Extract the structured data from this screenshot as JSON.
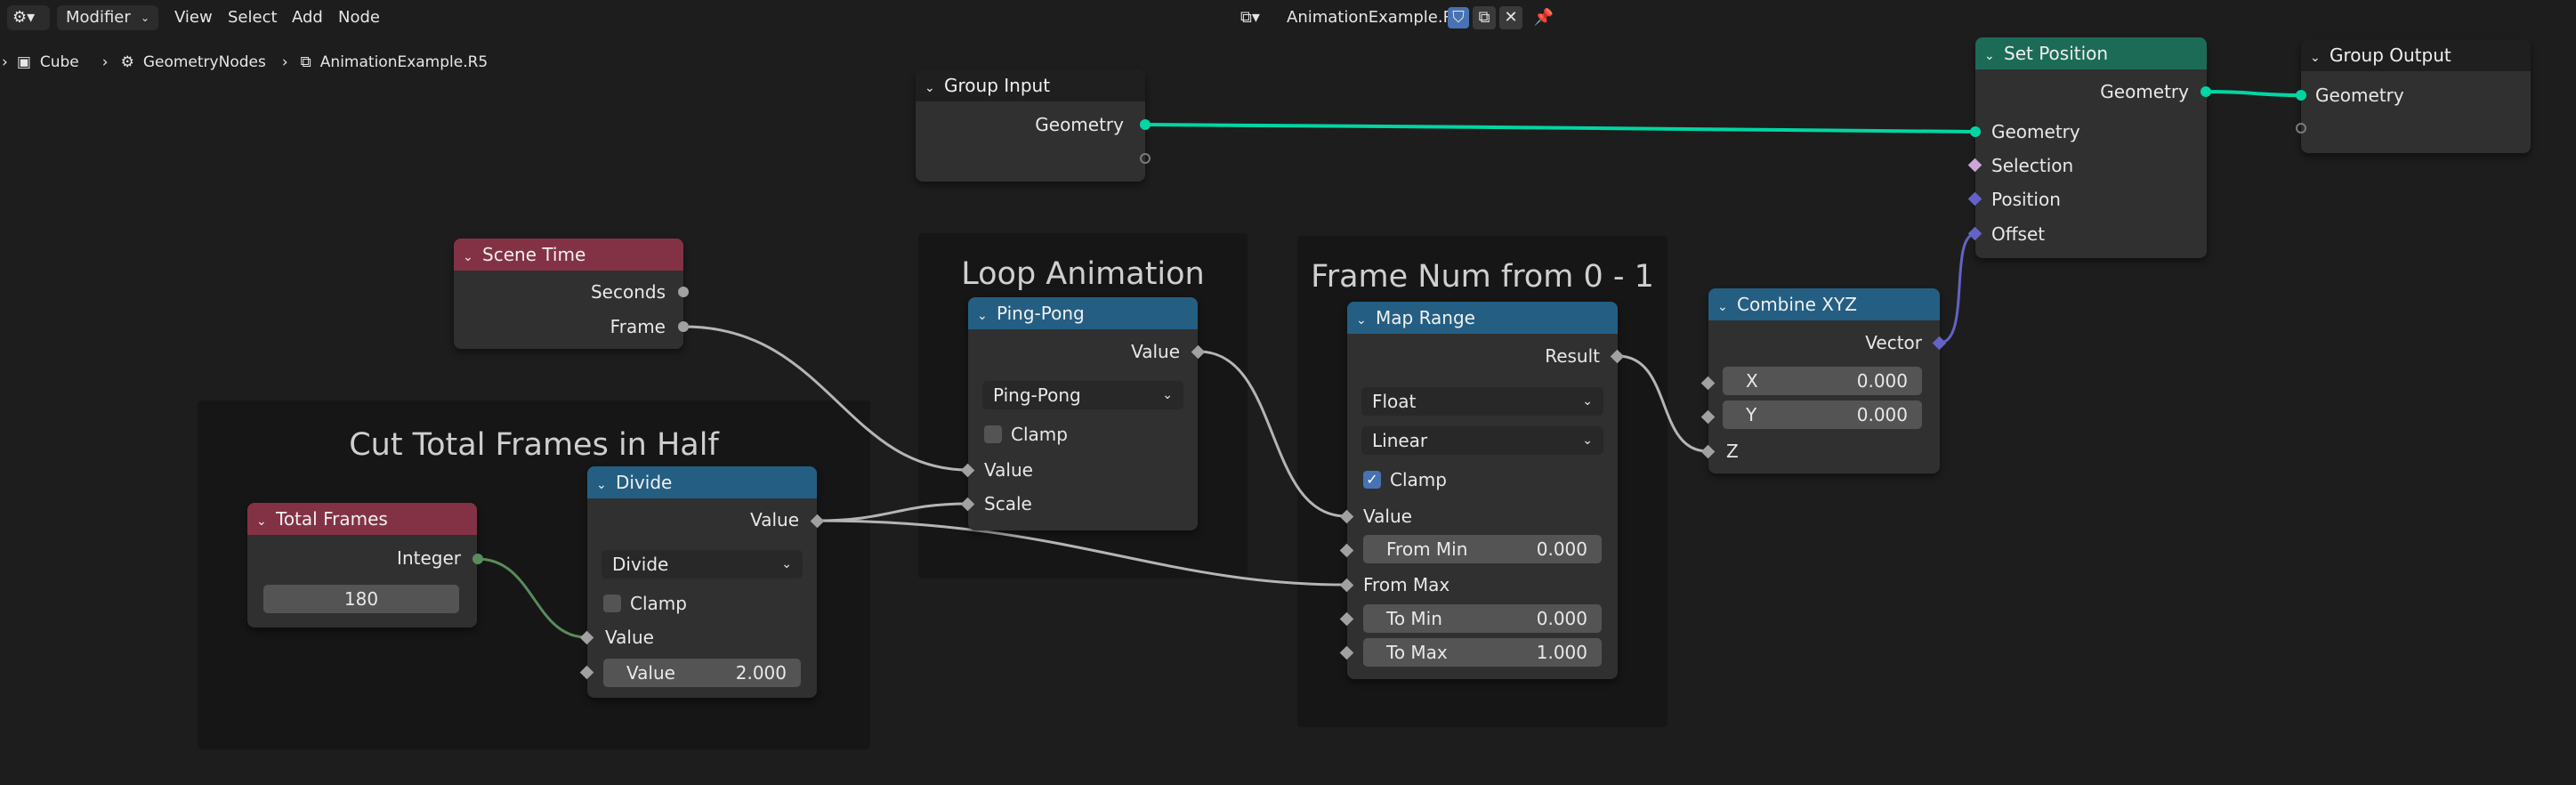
{
  "header": {
    "editor_type_icon": "node-editor-icon",
    "mode": "Modifier",
    "menus": [
      "View",
      "Select",
      "Add",
      "Node"
    ],
    "node_tree_name": "AnimationExample.R5"
  },
  "breadcrumb": [
    "Cube",
    "GeometryNodes",
    "AnimationExample.R5"
  ],
  "frames": {
    "cut": "Cut Total Frames in Half",
    "loop": "Loop Animation",
    "framenum": "Frame Num from 0 - 1"
  },
  "nodes": {
    "group_input": {
      "title": "Group Input",
      "outputs": [
        "Geometry"
      ]
    },
    "scene_time": {
      "title": "Scene Time",
      "outputs": [
        "Seconds",
        "Frame"
      ]
    },
    "total_frames": {
      "title": "Total Frames",
      "output": "Integer",
      "value": "180"
    },
    "divide": {
      "title": "Divide",
      "output": "Value",
      "operation": "Divide",
      "clamp_label": "Clamp",
      "clamp": false,
      "input1": "Value",
      "input2_label": "Value",
      "input2_value": "2.000"
    },
    "ping_pong": {
      "title": "Ping-Pong",
      "output": "Value",
      "operation": "Ping-Pong",
      "clamp_label": "Clamp",
      "clamp": false,
      "inputs": [
        "Value",
        "Scale"
      ]
    },
    "map_range": {
      "title": "Map Range",
      "output": "Result",
      "data_type": "Float",
      "interpolation": "Linear",
      "clamp_label": "Clamp",
      "clamp": true,
      "value_label": "Value",
      "from_min_label": "From Min",
      "from_min": "0.000",
      "from_max_label": "From Max",
      "to_min_label": "To Min",
      "to_min": "0.000",
      "to_max_label": "To Max",
      "to_max": "1.000"
    },
    "combine_xyz": {
      "title": "Combine XYZ",
      "output": "Vector",
      "x_label": "X",
      "x": "0.000",
      "y_label": "Y",
      "y": "0.000",
      "z_label": "Z"
    },
    "set_position": {
      "title": "Set Position",
      "output": "Geometry",
      "inputs": [
        "Geometry",
        "Selection",
        "Position",
        "Offset"
      ]
    },
    "group_output": {
      "title": "Group Output",
      "inputs": [
        "Geometry"
      ]
    }
  },
  "colors": {
    "background": "#1d1d1d",
    "node_body": "#303030",
    "header_input": "#833246",
    "header_math": "#245f83",
    "header_geometry": "#1c6b57",
    "socket_geometry": "#00d6a3",
    "socket_float": "#a1a1a1",
    "socket_integer": "#598c5c",
    "socket_vector": "#6363c7",
    "checkbox_on": "#4772b3"
  }
}
